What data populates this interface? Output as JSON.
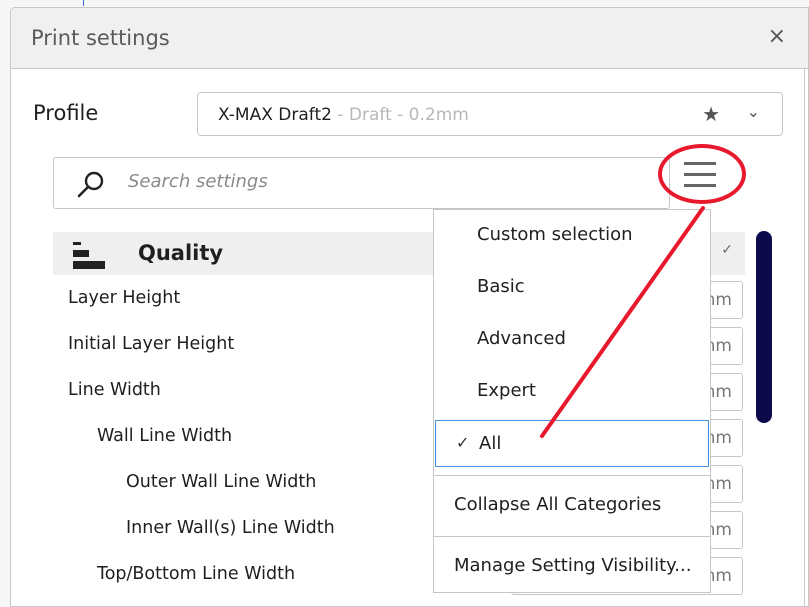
{
  "dialog": {
    "title": "Print settings",
    "close_icon": "×"
  },
  "profile": {
    "label": "Profile",
    "name": "X-MAX Draft2",
    "suffix": " - Draft - 0.2mm",
    "star_icon": "★",
    "chevron_icon": "⌄"
  },
  "search": {
    "placeholder": "Search settings",
    "value": ""
  },
  "category": {
    "label": "Quality",
    "check_icon": "✓"
  },
  "settings": [
    {
      "label": "Layer Height",
      "unit": "mm"
    },
    {
      "label": "Initial Layer Height",
      "unit": "mm"
    },
    {
      "label": "Line Width",
      "unit": "mm"
    },
    {
      "label": "Wall Line Width",
      "unit": "mm"
    },
    {
      "label": "Outer Wall Line Width",
      "unit": "mm"
    },
    {
      "label": "Inner Wall(s) Line Width",
      "unit": "mm"
    },
    {
      "label": "Top/Bottom Line Width",
      "unit": "mm"
    }
  ],
  "visibility_menu": {
    "items": [
      {
        "label": "Custom selection",
        "selected": false
      },
      {
        "label": "Basic",
        "selected": false
      },
      {
        "label": "Advanced",
        "selected": false
      },
      {
        "label": "Expert",
        "selected": false
      },
      {
        "label": "All",
        "selected": true
      }
    ],
    "check_icon": "✓",
    "actions": [
      {
        "label": "Collapse All Categories"
      },
      {
        "label": "Manage Setting Visibility..."
      }
    ]
  },
  "annotation": {
    "color": "#e8192c"
  }
}
